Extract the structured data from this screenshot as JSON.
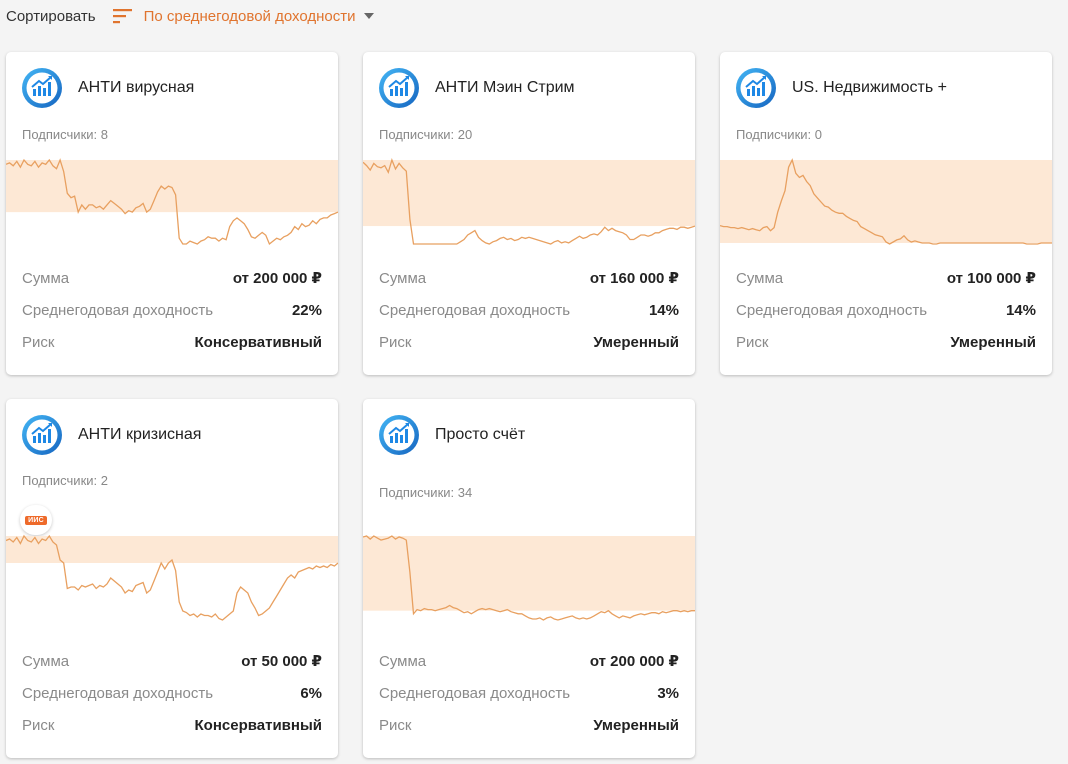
{
  "sort": {
    "label": "Сортировать",
    "selected": "По среднегодовой доходности",
    "icon": "sort-lines-icon",
    "accent": "#e0742e"
  },
  "colors": {
    "chart_line": "#e8a060",
    "chart_fill": "#fde8d5",
    "tag_bg": "#ee6a2a",
    "logo_blue": "#1e88e5"
  },
  "labels": {
    "amount": "Сумма",
    "yield": "Среднегодовая доходность",
    "risk": "Риск"
  },
  "cards": [
    {
      "title": "АНТИ вирусная",
      "subscribers": "Подписчики: 8",
      "amount": "от 200 000 ₽",
      "yield": "22%",
      "risk": "Консервативный",
      "chart_data": {
        "type": "area",
        "y": [
          55,
          56,
          54,
          57,
          53,
          58,
          55,
          54,
          57,
          53,
          56,
          55,
          58,
          54,
          52,
          58,
          50,
          35,
          32,
          33,
          22,
          27,
          24,
          27,
          27,
          25,
          26,
          24,
          27,
          30,
          28,
          26,
          24,
          21,
          23,
          22,
          25,
          26,
          28,
          22,
          24,
          30,
          36,
          40,
          38,
          40,
          39,
          34,
          4,
          0,
          0,
          2,
          1,
          0,
          2,
          3,
          5,
          4,
          4,
          2,
          4,
          3,
          12,
          16,
          18,
          16,
          14,
          10,
          5,
          4,
          6,
          8,
          6,
          0,
          2,
          4,
          3,
          5,
          6,
          8,
          12,
          10,
          14,
          12,
          13,
          16,
          14,
          17,
          18,
          18,
          20,
          21,
          22
        ]
      }
    },
    {
      "title": "АНТИ Мэин Стрим",
      "subscribers": "Подписчики: 20",
      "amount": "от 160 000 ₽",
      "yield": "14%",
      "risk": "Умеренный",
      "chart_data": {
        "type": "area",
        "y": [
          73,
          70,
          66,
          72,
          69,
          68,
          70,
          64,
          75,
          67,
          72,
          68,
          65,
          22,
          0,
          0,
          0,
          0,
          0,
          0,
          0,
          0,
          0,
          0,
          0,
          0,
          0,
          2,
          4,
          8,
          10,
          12,
          6,
          3,
          1,
          0,
          2,
          3,
          5,
          6,
          4,
          5,
          3,
          4,
          6,
          5,
          6,
          5,
          4,
          3,
          2,
          1,
          0,
          2,
          3,
          1,
          2,
          1,
          3,
          5,
          7,
          5,
          6,
          8,
          9,
          8,
          11,
          15,
          12,
          14,
          12,
          11,
          10,
          8,
          4,
          4,
          6,
          8,
          8,
          7,
          8,
          10,
          10,
          12,
          13,
          14,
          14,
          13,
          15,
          15,
          14,
          15,
          16
        ]
      }
    },
    {
      "title": "US. Недвижимость +",
      "subscribers": "Подписчики: 0",
      "amount": "от 100 000 ₽",
      "yield": "14%",
      "risk": "Умеренный",
      "chart_data": {
        "type": "area",
        "y": [
          21,
          20,
          20,
          19,
          19,
          18,
          19,
          18,
          17,
          18,
          17,
          16,
          19,
          20,
          16,
          19,
          34,
          45,
          55,
          78,
          85,
          72,
          68,
          70,
          64,
          60,
          52,
          48,
          44,
          40,
          39,
          36,
          34,
          33,
          33,
          30,
          28,
          26,
          25,
          20,
          18,
          16,
          14,
          12,
          11,
          10,
          5,
          3,
          5,
          7,
          8,
          11,
          7,
          5,
          6,
          5,
          4,
          4,
          4,
          3,
          3,
          4,
          4,
          4,
          4,
          4,
          4,
          4,
          4,
          4,
          4,
          4,
          4,
          4,
          4,
          4,
          4,
          4,
          4,
          4,
          4,
          4,
          4,
          4,
          4,
          3,
          3,
          3,
          3,
          4,
          4,
          4,
          4
        ]
      }
    },
    {
      "title": "АНТИ кризисная",
      "subscribers": "Подписчики: 2",
      "badge": "ИИС",
      "amount": "от 50 000 ₽",
      "yield": "6%",
      "risk": "Консервативный",
      "chart_data": {
        "type": "area",
        "y": [
          55,
          56,
          54,
          57,
          53,
          58,
          55,
          54,
          57,
          53,
          56,
          55,
          58,
          54,
          52,
          42,
          40,
          23,
          24,
          24,
          22,
          25,
          24,
          25,
          26,
          23,
          25,
          24,
          26,
          30,
          28,
          26,
          24,
          20,
          22,
          21,
          25,
          26,
          27,
          20,
          22,
          28,
          34,
          40,
          36,
          40,
          42,
          35,
          14,
          8,
          7,
          5,
          6,
          4,
          6,
          5,
          5,
          4,
          6,
          3,
          2,
          4,
          6,
          8,
          20,
          24,
          22,
          20,
          14,
          10,
          5,
          6,
          8,
          10,
          14,
          18,
          22,
          26,
          30,
          32,
          30,
          34,
          35,
          36,
          37,
          36,
          38,
          37,
          38,
          37,
          39,
          38,
          40
        ]
      }
    },
    {
      "title": "Просто счёт",
      "subscribers": "Подписчики: 34",
      "amount": "от 200 000 ₽",
      "yield": "3%",
      "risk": "Умеренный",
      "chart_data": {
        "type": "area",
        "y": [
          74,
          75,
          72,
          75,
          73,
          71,
          72,
          73,
          75,
          72,
          74,
          73,
          71,
          40,
          0,
          4,
          3,
          5,
          4,
          4,
          3,
          4,
          5,
          6,
          8,
          6,
          5,
          3,
          1,
          2,
          0,
          2,
          4,
          5,
          4,
          5,
          4,
          3,
          2,
          3,
          4,
          2,
          1,
          0,
          0,
          -2,
          -4,
          -5,
          -5,
          -4,
          -6,
          -4,
          -3,
          -5,
          -6,
          -5,
          -4,
          -3,
          -2,
          -4,
          -5,
          -4,
          -5,
          -4,
          -2,
          0,
          2,
          1,
          3,
          0,
          -2,
          -4,
          -2,
          -3,
          -4,
          -2,
          -1,
          0,
          -1,
          0,
          1,
          1,
          0,
          2,
          1,
          2,
          3,
          3,
          2,
          3,
          2,
          3,
          3
        ]
      }
    }
  ]
}
